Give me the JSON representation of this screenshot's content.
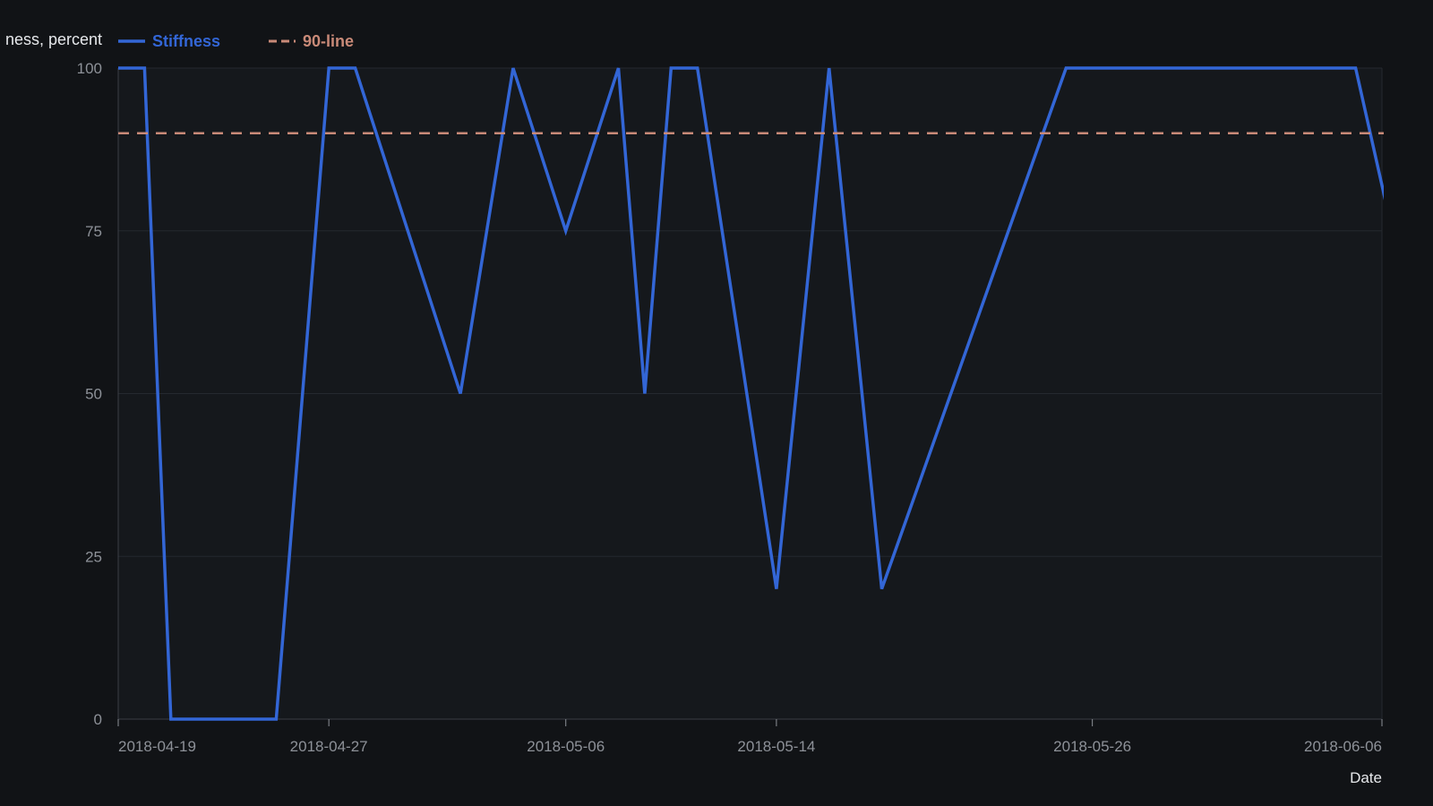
{
  "chart_data": {
    "type": "line",
    "title": "",
    "ylabel": "ness, percent",
    "xlabel": "Date",
    "ylim": [
      0,
      100
    ],
    "yticks": [
      0,
      25,
      50,
      75,
      100
    ],
    "xticks": [
      "2018-04-19",
      "2018-04-27",
      "2018-05-06",
      "2018-05-14",
      "2018-05-26",
      "2018-06-06"
    ],
    "xlim": [
      "2018-04-19",
      "2018-06-06"
    ],
    "grid": true,
    "legend_position": "top-left",
    "series": [
      {
        "name": "Stiffness",
        "color": "#3366d6",
        "style": "solid",
        "points": [
          {
            "x": "2018-04-19",
            "y": 100
          },
          {
            "x": "2018-04-20",
            "y": 100
          },
          {
            "x": "2018-04-21",
            "y": 0
          },
          {
            "x": "2018-04-25",
            "y": 0
          },
          {
            "x": "2018-04-27",
            "y": 100
          },
          {
            "x": "2018-04-28",
            "y": 100
          },
          {
            "x": "2018-05-02",
            "y": 50
          },
          {
            "x": "2018-05-04",
            "y": 100
          },
          {
            "x": "2018-05-06",
            "y": 75
          },
          {
            "x": "2018-05-08",
            "y": 100
          },
          {
            "x": "2018-05-09",
            "y": 50
          },
          {
            "x": "2018-05-10",
            "y": 100
          },
          {
            "x": "2018-05-11",
            "y": 100
          },
          {
            "x": "2018-05-14",
            "y": 20
          },
          {
            "x": "2018-05-16",
            "y": 100
          },
          {
            "x": "2018-05-18",
            "y": 20
          },
          {
            "x": "2018-05-25",
            "y": 100
          },
          {
            "x": "2018-06-05",
            "y": 100
          },
          {
            "x": "2018-06-07",
            "y": 64
          }
        ]
      },
      {
        "name": "90-line",
        "color": "#c98a78",
        "style": "dashed",
        "points": [
          {
            "x": "2018-04-19",
            "y": 90
          },
          {
            "x": "2018-06-07",
            "y": 90
          }
        ]
      }
    ]
  }
}
